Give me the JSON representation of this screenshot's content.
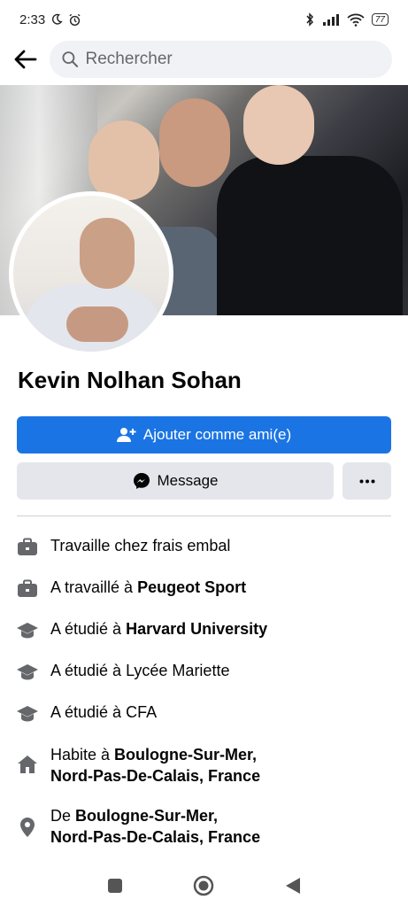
{
  "status_bar": {
    "time": "2:33",
    "battery": "77"
  },
  "search": {
    "placeholder": "Rechercher"
  },
  "profile": {
    "name": "Kevin Nolhan Sohan"
  },
  "actions": {
    "add_friend_label": "Ajouter comme ami(e)",
    "message_label": "Message",
    "more_label": "···"
  },
  "info": {
    "work_current": {
      "prefix": "Travaille chez frais embal"
    },
    "work_past": {
      "prefix": "A travaillé à ",
      "bold": "Peugeot Sport"
    },
    "edu1": {
      "prefix": "A étudié à ",
      "bold": "Harvard University"
    },
    "edu2": {
      "prefix": "A étudié à Lycée Mariette"
    },
    "edu3": {
      "prefix": "A étudié à CFA"
    },
    "lives": {
      "prefix": "Habite à ",
      "bold1": "Boulogne-Sur-Mer,",
      "bold2": "Nord-Pas-De-Calais, France"
    },
    "from": {
      "prefix": "De ",
      "bold1": "Boulogne-Sur-Mer,",
      "bold2": "Nord-Pas-De-Calais, France"
    }
  },
  "colors": {
    "primary": "#1b74e4",
    "secondary_bg": "#e4e6eb",
    "icon_gray": "#65676b"
  },
  "icons": {
    "back": "arrow-left-icon",
    "search": "search-icon",
    "add_friend": "user-plus-icon",
    "messenger": "messenger-icon",
    "more": "more-dots-icon",
    "work": "briefcase-icon",
    "education": "graduation-cap-icon",
    "home": "home-icon",
    "location": "location-pin-icon"
  }
}
